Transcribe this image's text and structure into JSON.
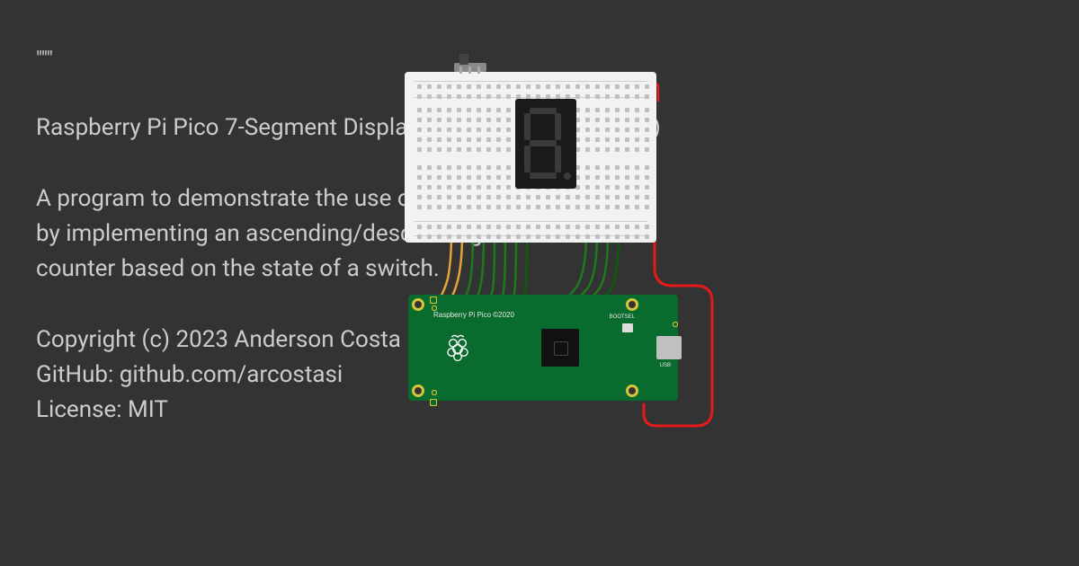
{
  "code": {
    "docstring_open": "\"\"\"",
    "title": "Raspberry Pi Pico 7-Segment Display Counter (MicroPython)",
    "description_l1": "A program to demonstrate the use of a 7-segment display",
    "description_l2": "by implementing an ascending/descending hexadecimal",
    "description_l3": "counter based on the state of a switch.",
    "copyright": "Copyright (c) 2023 Anderson Costa",
    "github": "GitHub: github.com/arcostasi",
    "license": "License: MIT"
  },
  "board": {
    "label": "Raspberry Pi Pico ©2020",
    "bootsel": "BOOTSEL",
    "usb": "USB"
  },
  "components": {
    "breadboard": "breadboard",
    "seven_segment": "7-segment-display",
    "switch": "slide-switch",
    "pico": "raspberry-pi-pico"
  },
  "wire_colors": {
    "power": "#e41a1a",
    "signal": "#1f7a1f",
    "darkgreen": "#0e5a0e",
    "alt": "#e5a33a"
  }
}
